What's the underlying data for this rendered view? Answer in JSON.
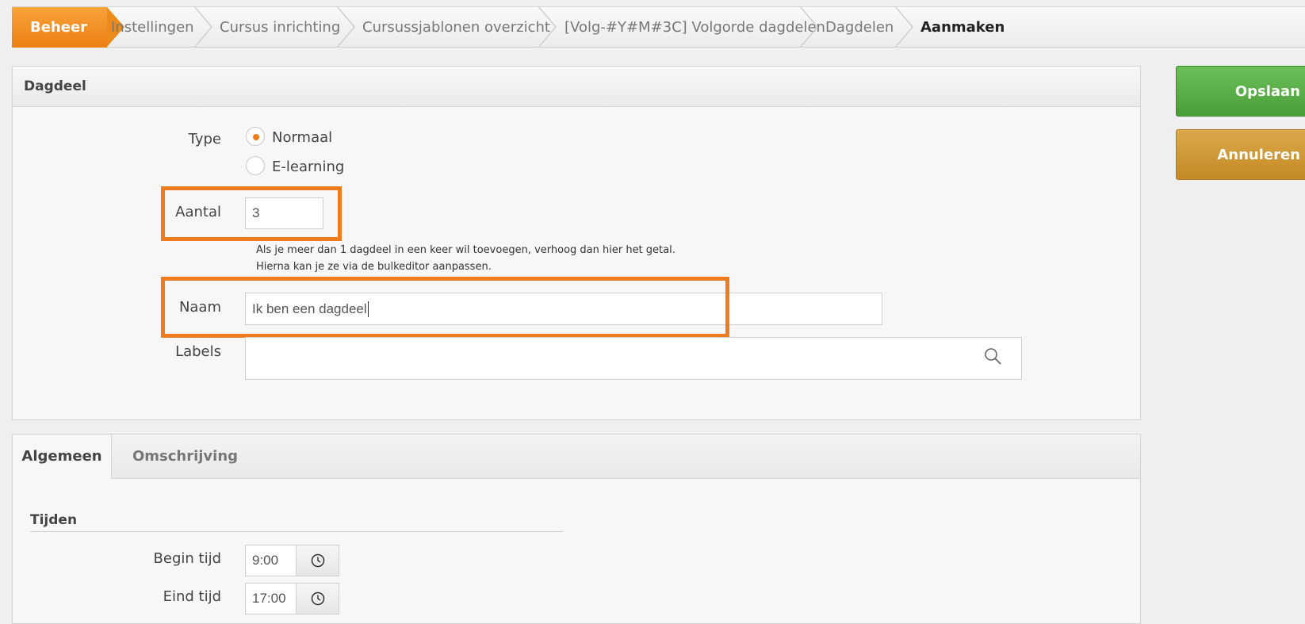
{
  "breadcrumb": {
    "items": [
      "Beheer",
      "Instellingen",
      "Cursus inrichting",
      "Cursussjablonen overzicht",
      "[Volg-#Y#M#3C] Volgorde dagdelen",
      "Dagdelen",
      "Aanmaken"
    ]
  },
  "actions": {
    "save_label": "Opslaan",
    "cancel_label": "Annuleren"
  },
  "dagdeel_panel": {
    "title": "Dagdeel",
    "type_label": "Type",
    "type_options": [
      "Normaal",
      "E-learning"
    ],
    "type_selected": "Normaal",
    "aantal_label": "Aantal",
    "aantal_value": "3",
    "hint_line1": "Als je meer dan 1 dagdeel in een keer wil toevoegen, verhoog dan hier het getal.",
    "hint_line2": "Hierna kan je ze via de bulkeditor aanpassen.",
    "naam_label": "Naam",
    "naam_value": "Ik ben een dagdeel",
    "labels_label": "Labels",
    "labels_value": ""
  },
  "detail_panel": {
    "tabs": [
      "Algemeen",
      "Omschrijving"
    ],
    "active_tab": "Algemeen",
    "section_title": "Tijden",
    "begin_label": "Begin tijd",
    "begin_value": "9:00",
    "end_label": "Eind tijd",
    "end_value": "17:00"
  },
  "icons": {
    "search": "search-icon",
    "clock": "clock-icon"
  },
  "colors": {
    "accent": "#ee7b1e",
    "save": "#5cb048",
    "cancel": "#d09a36"
  }
}
